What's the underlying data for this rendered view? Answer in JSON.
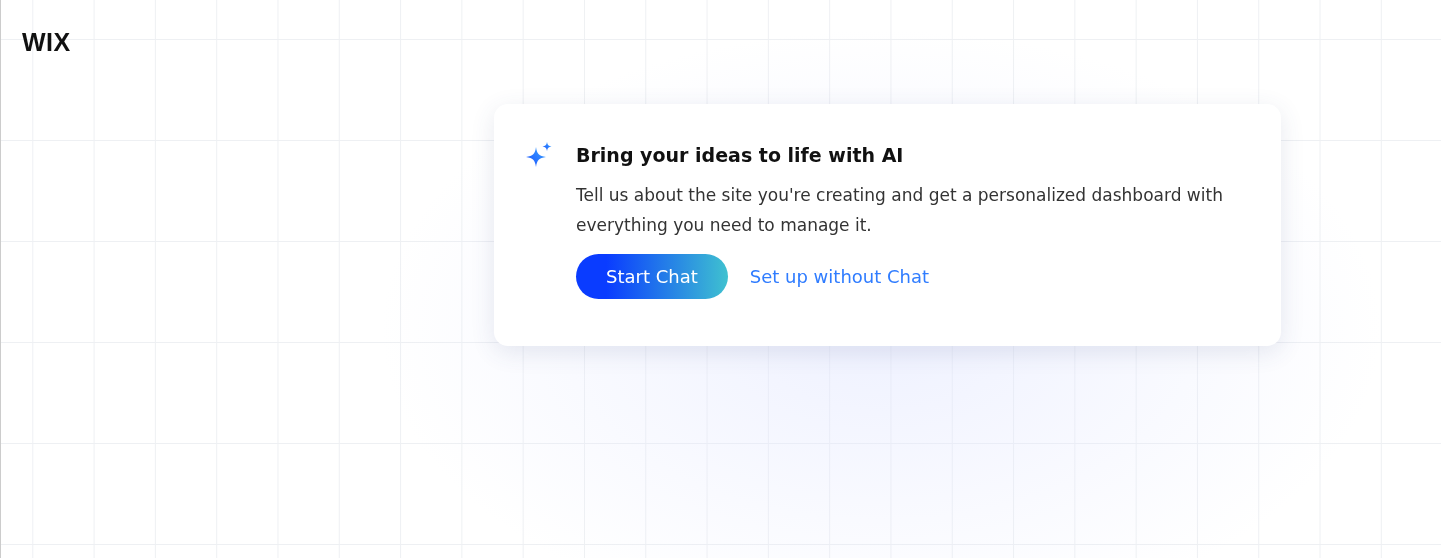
{
  "logo": "WIX",
  "card": {
    "title": "Bring your ideas to life with AI",
    "description": "Tell us about the site you're creating and get a personalized dashboard with everything you need to manage it.",
    "primary_button": "Start Chat",
    "secondary_link": "Set up without Chat"
  }
}
